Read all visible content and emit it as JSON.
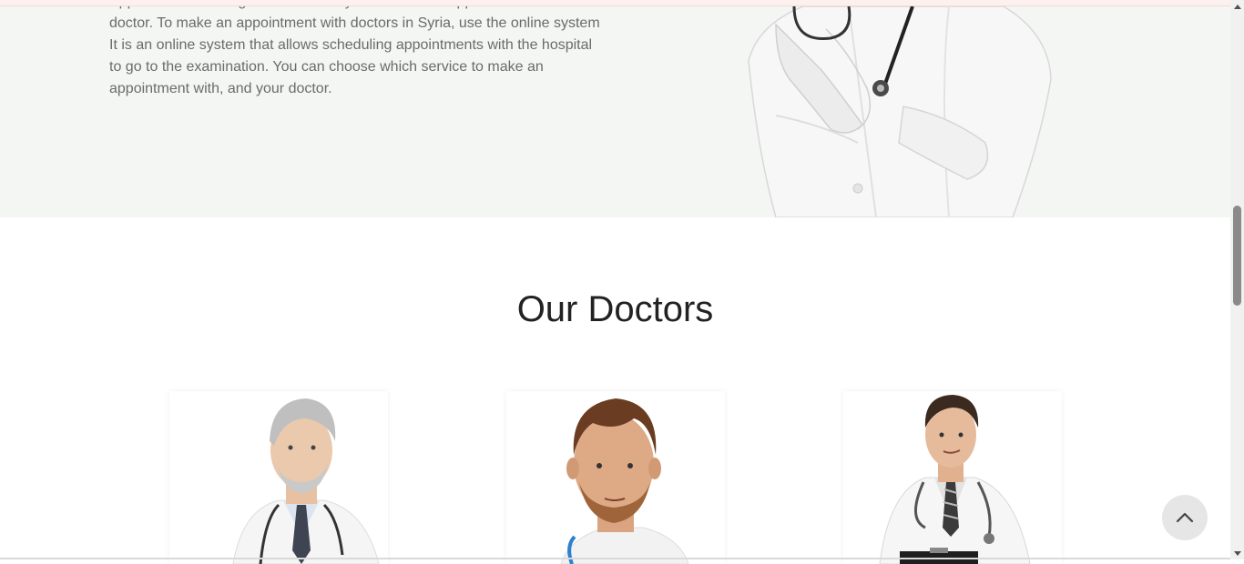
{
  "about": {
    "text": "Appointment booking service allows you to make an appointment with a doctor. To make an appointment with doctors in Syria, use the online system It is an online system that allows scheduling appointments with the hospital to go to the examination. You can choose which service to make an appointment with, and your doctor."
  },
  "doctors": {
    "title": "Our Doctors",
    "cards": [
      {
        "icon": "doctor-photo-senior"
      },
      {
        "icon": "doctor-photo-bearded"
      },
      {
        "icon": "doctor-photo-young"
      }
    ]
  },
  "controls": {
    "back_to_top_icon": "chevron-up-icon"
  },
  "colors": {
    "about_background": "#f3f6f3",
    "text_gray": "#6b6b6b",
    "title": "#222222",
    "back_to_top_bg": "#e6e6e6"
  }
}
